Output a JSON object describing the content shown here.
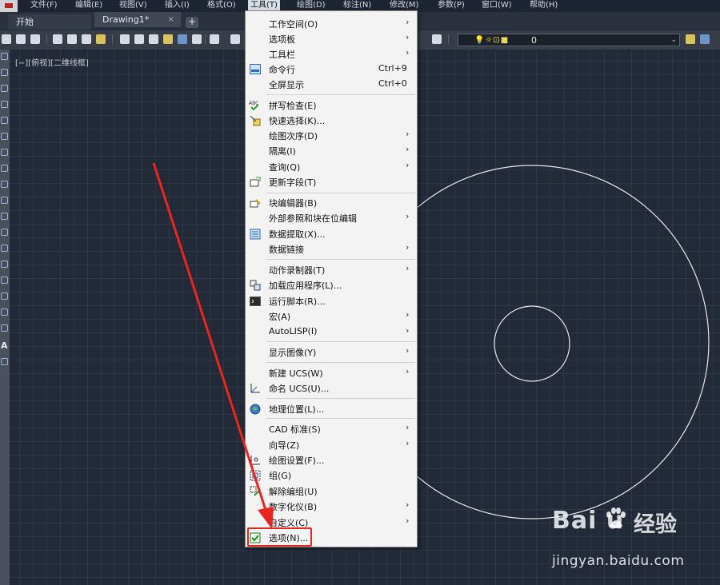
{
  "menubar": {
    "items": [
      "文件(F)",
      "编辑(E)",
      "视图(V)",
      "插入(I)",
      "格式(O)",
      "工具(T)",
      "绘图(D)",
      "标注(N)",
      "修改(M)",
      "参数(P)",
      "窗口(W)",
      "帮助(H)"
    ],
    "active": "工具(T)"
  },
  "tabs": {
    "start": "开始",
    "drawing": "Drawing1*",
    "close": "×",
    "add": "+"
  },
  "layer": {
    "icons": "💡☼⊡■",
    "value": "0",
    "arrow": "⌄"
  },
  "viewport": {
    "label": "[−][俯视][二维线框]"
  },
  "lefttools": {
    "text_tool": "A"
  },
  "menu": {
    "items": [
      {
        "label": "工作空间(O)",
        "submenu": true
      },
      {
        "label": "选项板",
        "submenu": true
      },
      {
        "label": "工具栏",
        "submenu": true
      },
      {
        "label": "命令行",
        "shortcut": "Ctrl+9",
        "icon": "command-line-icon"
      },
      {
        "label": "全屏显示",
        "shortcut": "Ctrl+0"
      },
      {
        "label": "拼写检查(E)",
        "icon": "spell-check-icon"
      },
      {
        "label": "快速选择(K)...",
        "icon": "quick-select-icon"
      },
      {
        "label": "绘图次序(D)",
        "submenu": true
      },
      {
        "label": "隔离(I)",
        "submenu": true
      },
      {
        "label": "查询(Q)",
        "submenu": true
      },
      {
        "label": "更新字段(T)",
        "icon": "update-field-icon"
      },
      {
        "label": "块编辑器(B)",
        "icon": "block-editor-icon"
      },
      {
        "label": "外部参照和块在位编辑",
        "submenu": true
      },
      {
        "label": "数据提取(X)...",
        "icon": "data-extraction-icon"
      },
      {
        "label": "数据链接",
        "submenu": true
      },
      {
        "label": "动作录制器(T)",
        "submenu": true
      },
      {
        "label": "加载应用程序(L)...",
        "icon": "load-application-icon"
      },
      {
        "label": "运行脚本(R)...",
        "icon": "run-script-icon"
      },
      {
        "label": "宏(A)",
        "submenu": true
      },
      {
        "label": "AutoLISP(I)",
        "submenu": true
      },
      {
        "label": "显示图像(Y)",
        "submenu": true
      },
      {
        "label": "新建 UCS(W)",
        "submenu": true
      },
      {
        "label": "命名 UCS(U)...",
        "icon": "named-ucs-icon"
      },
      {
        "label": "地理位置(L)...",
        "icon": "geolocation-icon"
      },
      {
        "label": "CAD 标准(S)",
        "submenu": true
      },
      {
        "label": "向导(Z)",
        "submenu": true
      },
      {
        "label": "绘图设置(F)...",
        "icon": "drafting-settings-icon"
      },
      {
        "label": "组(G)",
        "icon": "group-icon"
      },
      {
        "label": "解除编组(U)",
        "icon": "ungroup-icon"
      },
      {
        "label": "数字化仪(B)",
        "submenu": true
      },
      {
        "label": "自定义(C)",
        "submenu": true
      },
      {
        "label": "选项(N)...",
        "icon": "options-icon"
      }
    ],
    "submenu_arrow": "›"
  },
  "watermark": {
    "logo": "Bai  u",
    "cn": "经验",
    "sub": "jingyan.baidu.com"
  },
  "colors": {
    "highlight": "#e8251f",
    "arrow": "#e8251f",
    "circle": "#e6e6e6",
    "grid": "#2e3645",
    "background": "#222a37"
  }
}
